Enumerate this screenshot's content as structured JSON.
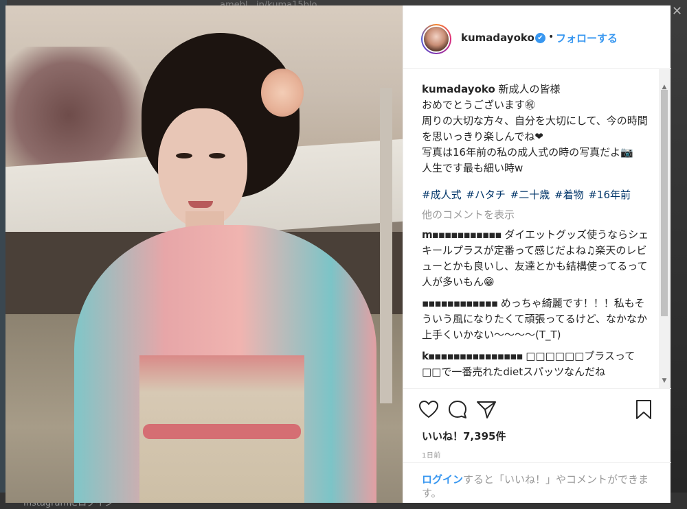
{
  "background": {
    "url_text": "amebl...jp/kuma15blo",
    "bottom_text": "Instagramにログイン"
  },
  "post": {
    "username": "kumadayoko",
    "follow_label": "フォローする",
    "separator": "•",
    "caption_user": "kumadayoko",
    "caption_lines": [
      "新成人の皆様",
      "おめでとうございます㊗",
      "周りの大切な方々、自分を大切にして、今の時間を思いっきり楽しんでね❤",
      "写真は16年前の私の成人式の時の写真だよ📷",
      "人生です最も細い時w"
    ],
    "hashtags": "#成人式 #ハタチ #二十歳 #着物 #16年前",
    "view_more": "他のコメントを表示",
    "comments": [
      {
        "user": "m▪▪▪▪▪▪▪▪▪▪▪",
        "text": "ダイエットグッズ使うならシェキールプラスが定番って感じだよね♫楽天のレビューとかも良いし、友達とかも結構使ってるって人が多いもん😁"
      },
      {
        "user": "▪▪▪▪▪▪▪▪▪▪▪▪",
        "text": "めっちゃ綺麗です！！！私もそういう風になりたくて頑張ってるけど、なかなか上手くいかない〜〜〜〜(T_T)"
      },
      {
        "user": "k▪▪▪▪▪▪▪▪▪▪▪▪▪▪▪",
        "text": "□□□□□□プラスって□□で一番売れたdietスパッツなんだね"
      }
    ],
    "likes": "いいね！7,395件",
    "time": "1日前",
    "login_link": "ログイン",
    "login_rest": "すると「いいね！」やコメントができます。"
  },
  "icons": [
    "heart-icon",
    "comment-icon",
    "share-icon",
    "bookmark-icon",
    "verified-badge-icon"
  ],
  "colors": {
    "link_blue": "#3897f0",
    "hashtag": "#003569",
    "text": "#262626",
    "muted": "#999999"
  }
}
